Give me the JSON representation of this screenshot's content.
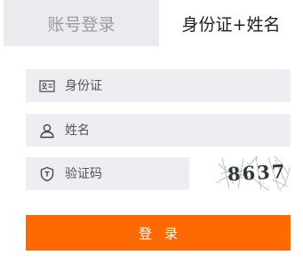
{
  "tabs": {
    "account_login": "账号登录",
    "id_name": "身份证+姓名"
  },
  "fields": {
    "id_card": {
      "placeholder": "身份证",
      "icon": "id-card-icon"
    },
    "name": {
      "placeholder": "姓名",
      "icon": "user-icon"
    },
    "captcha": {
      "placeholder": "验证码",
      "icon": "shield-icon"
    }
  },
  "captcha_image": {
    "text": "8637"
  },
  "login_button": {
    "label": "登录"
  },
  "colors": {
    "accent": "#ff6a00",
    "tab_inactive_bg": "#ebeaef",
    "field_bg": "#ededf2"
  }
}
